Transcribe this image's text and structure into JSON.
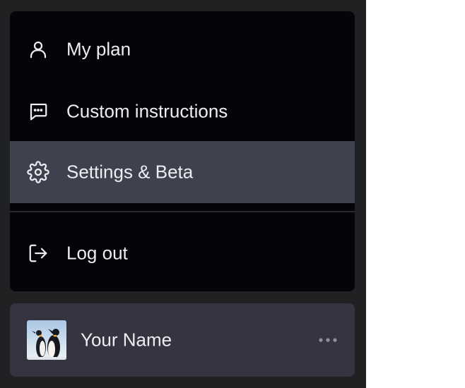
{
  "menu": {
    "items": [
      {
        "label": "My plan",
        "icon": "user-icon"
      },
      {
        "label": "Custom instructions",
        "icon": "chat-bubble-icon"
      },
      {
        "label": "Settings & Beta",
        "icon": "gear-icon",
        "active": true
      },
      {
        "label": "Log out",
        "icon": "logout-icon"
      }
    ]
  },
  "profile": {
    "name": "Your Name",
    "avatar": "penguins-avatar",
    "more_icon": "more-horizontal-icon"
  },
  "colors": {
    "sidebar_bg": "#202123",
    "menu_bg": "#050509",
    "active_bg": "#40414f",
    "profile_bg": "#343541",
    "text": "#ececf1"
  }
}
